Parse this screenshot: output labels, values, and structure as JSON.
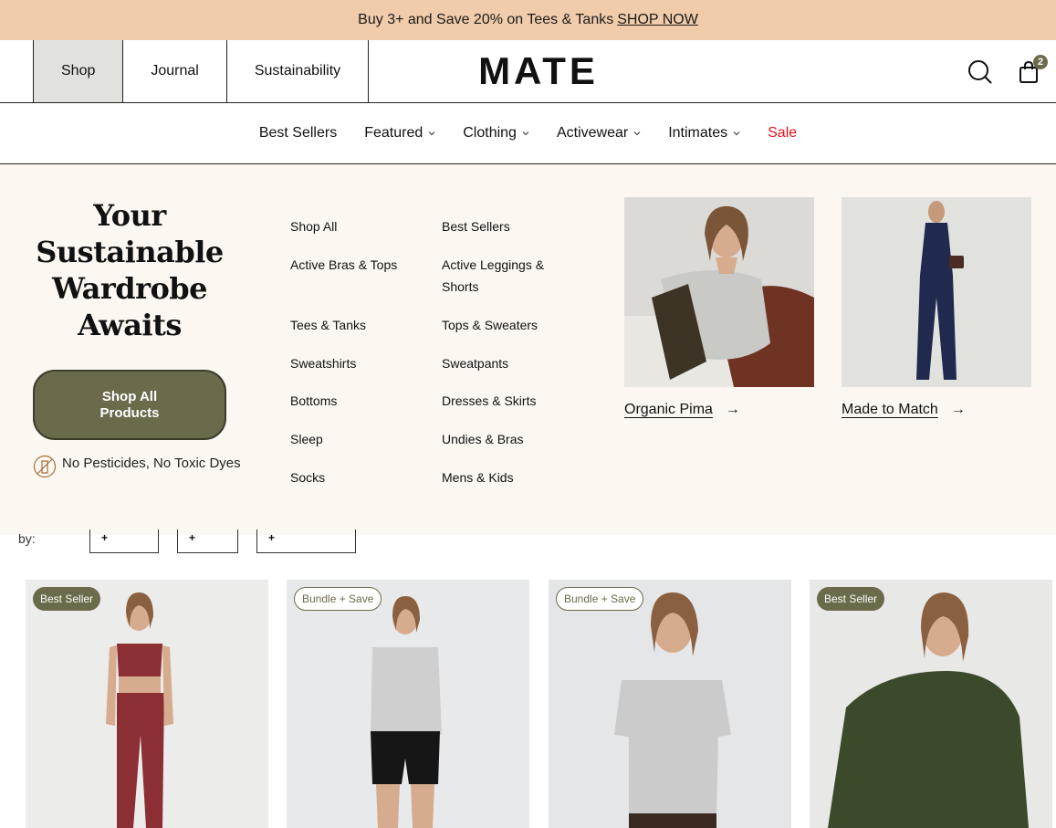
{
  "announcement": {
    "text": "Buy 3+ and Save 20% on Tees & Tanks",
    "link": "SHOP NOW"
  },
  "header": {
    "tabs": [
      "Shop",
      "Journal",
      "Sustainability"
    ],
    "logo": "MATE",
    "cart_count": "2"
  },
  "catnav": {
    "items": [
      {
        "label": "Best Sellers"
      },
      {
        "label": "Featured"
      },
      {
        "label": "Clothing"
      },
      {
        "label": "Activewear"
      },
      {
        "label": "Intimates"
      },
      {
        "label": "Sale"
      }
    ]
  },
  "mega": {
    "headline": "Your Sustainable Wardrobe Awaits",
    "cta": "Shop All Products",
    "note": "No Pesticides, No Toxic Dyes",
    "col1": [
      "Shop All",
      "Active Bras & Tops",
      "Tees & Tanks",
      "Sweatshirts",
      "Bottoms",
      "Sleep",
      "Socks"
    ],
    "col2": [
      "Best Sellers",
      "Active Leggings & Shorts",
      "Tops & Sweaters",
      "Sweatpants",
      "Dresses & Skirts",
      "Undies & Bras",
      "Mens & Kids"
    ],
    "promos": [
      {
        "label": "Organic Pima"
      },
      {
        "label": "Made to Match"
      }
    ]
  },
  "filters": {
    "by": "by:"
  },
  "products": [
    {
      "badge": "Best Seller"
    },
    {
      "badge": "Bundle + Save"
    },
    {
      "badge": "Bundle + Save"
    },
    {
      "badge": "Best Seller"
    }
  ],
  "colors": {
    "accent": "#6b6a4b",
    "announce_bg": "#f0ccaa",
    "mega_bg": "#fcf8f1",
    "sale": "#e2141a"
  }
}
